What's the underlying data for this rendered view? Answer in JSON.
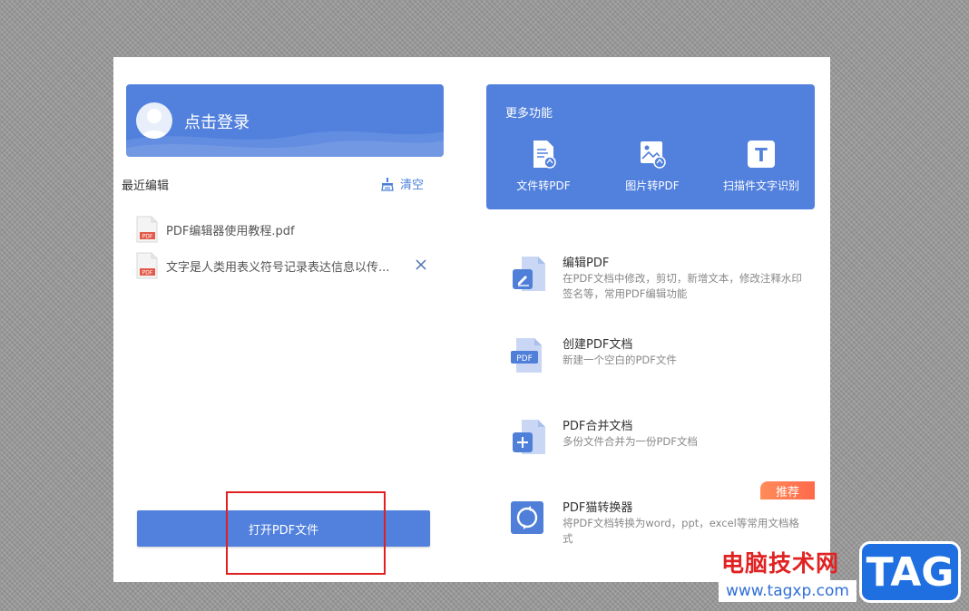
{
  "login": {
    "label": "点击登录"
  },
  "recent": {
    "title": "最近编辑",
    "clear_label": "清空",
    "files": [
      {
        "name": "PDF编辑器使用教程.pdf",
        "icon_label": "PDF"
      },
      {
        "name": "文字是人类用表义符号记录表达信息以传...",
        "icon_label": "PDF"
      }
    ]
  },
  "open_button": {
    "label": "打开PDF文件"
  },
  "more": {
    "title": "更多功能",
    "functions": [
      {
        "label": "文件转PDF",
        "icon": "file-to-pdf-icon"
      },
      {
        "label": "图片转PDF",
        "icon": "image-to-pdf-icon"
      },
      {
        "label": "扫描件文字识别",
        "icon": "text-recognition-icon",
        "glyph": "T"
      }
    ]
  },
  "features": [
    {
      "title": "编辑PDF",
      "desc": "在PDF文档中修改，剪切，新增文本，修改注释水印签名等，常用PDF编辑功能",
      "icon": "edit-pdf-icon"
    },
    {
      "title": "创建PDF文档",
      "desc": "新建一个空白的PDF文件",
      "icon": "create-pdf-icon",
      "icon_label": "PDF"
    },
    {
      "title": "PDF合并文档",
      "desc": "多份文件合并为一份PDF文档",
      "icon": "merge-pdf-icon"
    },
    {
      "title": "PDF猫转换器",
      "desc": "将PDF文档转换为word，ppt，excel等常用文档格式",
      "icon": "converter-icon",
      "badge": "推荐"
    }
  ],
  "watermark": {
    "site_name": "电脑技术网",
    "url": "www.tagxp.com",
    "logo": "TAG"
  },
  "colors": {
    "primary": "#5180dd",
    "badge": "#ff7a50",
    "highlight": "#e02020"
  }
}
